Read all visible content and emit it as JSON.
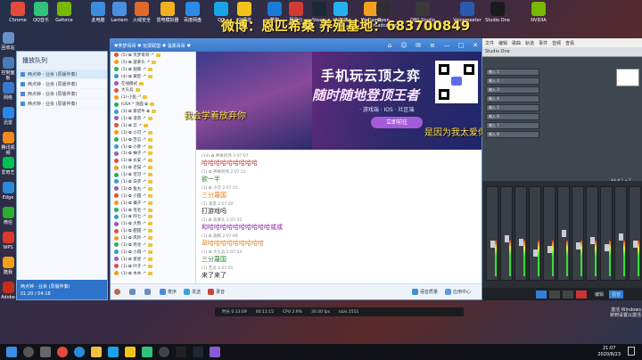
{
  "desktop": {
    "top_icons": [
      {
        "label": "Chrome",
        "color": "#e24b3b"
      },
      {
        "label": "QQ音乐",
        "color": "#31c27c"
      },
      {
        "label": "Geforce",
        "color": "#76b900"
      },
      {
        "label": "此电脑",
        "color": "#3c8ce0"
      },
      {
        "label": "Lantern",
        "color": "#4a8fe0"
      },
      {
        "label": "火绒安全",
        "color": "#e06a2a"
      },
      {
        "label": "雷电模拟器",
        "color": "#f0b020"
      },
      {
        "label": "百度网盘",
        "color": "#2a8ce8"
      },
      {
        "label": "QQ",
        "color": "#1aa3e8"
      },
      {
        "label": "YY语音",
        "color": "#f0c21a"
      },
      {
        "label": "酷狗",
        "color": "#1a7ad8"
      },
      {
        "label": "网易云",
        "color": "#d33a31"
      },
      {
        "label": "Steam",
        "color": "#1b2838"
      },
      {
        "label": "UU加速",
        "color": "#25b1f0"
      },
      {
        "label": "WeGame",
        "color": "#f2a020"
      },
      {
        "label": "Open Broadcaster",
        "color": "#302e31"
      },
      {
        "label": "OBS Studio",
        "color": "#3a3a3a"
      },
      {
        "label": "Voicemeeter",
        "color": "#2a5ab0"
      },
      {
        "label": "Studio One",
        "color": "#1a1a1a"
      },
      {
        "label": "NVIDIA",
        "color": "#76b900"
      }
    ],
    "left_icons": [
      {
        "label": "回收站",
        "color": "#6a90c8"
      },
      {
        "label": "控制面板",
        "color": "#4a7ab8"
      },
      {
        "label": "网络",
        "color": "#3a78d0"
      },
      {
        "label": "迅雷",
        "color": "#2a88e8"
      },
      {
        "label": "腾讯视频",
        "color": "#f08a1a"
      },
      {
        "label": "爱奇艺",
        "color": "#00c050"
      },
      {
        "label": "Edge",
        "color": "#2a8ad8"
      },
      {
        "label": "微信",
        "color": "#2aae32"
      },
      {
        "label": "WPS",
        "color": "#d83a2a"
      },
      {
        "label": "酷我",
        "color": "#f0a01a"
      },
      {
        "label": "Adobe",
        "color": "#c0301a"
      }
    ]
  },
  "overlay": {
    "title": "微博：恩匹希桑 养殖基地：683700849",
    "line_a": "我会学着放弃你",
    "line_b": "是因为我太爱你"
  },
  "playlist": {
    "title": "播放队列",
    "items": [
      "两点钟 - 业余 (原版伴奏)",
      "两点钟 - 业余 (原版伴奏)",
      "两点钟 - 业余 (原版伴奏)",
      "两点钟 - 业余 (原版伴奏)"
    ],
    "now_playing": "两点钟 - 业余 (原版伴奏)",
    "time": "01:20 / 04:18"
  },
  "chat": {
    "window_title": "♥笑梦哥哥 ♥ 玩耍联盟 ♥ 温柔哥哥 ♥",
    "members_header": "在线成员",
    "members": [
      "(5)-✿ 笑梦哥哥 -*",
      "(5)-✿ 菠萝头 -*",
      "(5)-✿ 翅膀 -*",
      "(4)-✿ 黄腔 -*",
      "在线模式",
      "大头兵",
      "(1)-小鱼 -*",
      "IUSA * 汤面 ✿",
      "(3)-✿ 斯诺牛 ✿",
      "(1)-✿ 漆黑 -*",
      "(1)-✿ 云 -*",
      "(1)-✿ 小可 -*",
      "(1)-✿ 苦瓜 -*",
      "(1)-✿ 小胖 -*",
      "(1)-✿ 柚子 -*",
      "(1)-✿ 长安 -*",
      "(1)-✿ 老猫 -*",
      "(1)-✿ 可可 -*",
      "(1)-✿ 白衣 -*",
      "(1)-✿ 鱼丸 -*",
      "(1)-✿ 小甜 -*",
      "(1)-✿ 橘子 -*",
      "(1)-✿ 毛毛 -*",
      "(1)-✿ 阿七 -*",
      "(1)-✿ 大熊 -*",
      "(1)-✿ 甜甜 -*",
      "(1)-✿ 风铃 -*",
      "(1)-✿ 月亮 -*",
      "(1)-✿ 小雨 -*",
      "(1)-✿ 星星 -*",
      "(1)-✿ 叶子 -*",
      "(1)-✿ 木木 -*"
    ],
    "banner": {
      "line1": "手机玩云顶之弈",
      "line2": "随时随地登顶王者",
      "line3": "· 游戏端 · IOS · 社区端",
      "cta": "立即前往"
    },
    "messages": [
      {
        "meta": "(14) ✿ 神奇阿伟 2:07:07",
        "body": "哈哈哈哈哈哈哈哈哈",
        "color": "#c0392b"
      },
      {
        "meta": "(1) ✿ 神奇阿伟 2:07:12",
        "body": "欲一半",
        "color": "#2e7d32"
      },
      {
        "meta": "(3) ✿ 小可 2:07:15",
        "body": "三分蔑国",
        "color": "#e67e22"
      },
      {
        "meta": "(1) 漆黑 2:07:20",
        "body": "打游戏吗",
        "color": "#222222"
      },
      {
        "meta": "(2) ✿ 菠萝头 2:07:35",
        "body": "和哈哈哈哈哈哈哈哈哈哈或或",
        "color": "#8e24aa"
      },
      {
        "meta": "(1) ✿ 翅膀 2:07:49",
        "body": "草哈哈哈哈哈哈哈哈哈",
        "color": "#e67e22"
      },
      {
        "meta": "(1) ✿ 大头兵 2:07:54",
        "body": "三分蔑国",
        "color": "#2e7d32"
      },
      {
        "meta": "(1) 苦瓜 2:07:55",
        "body": "来了来了",
        "color": "#222222"
      }
    ],
    "bottom": {
      "send": "发送",
      "mic": "麦序",
      "record": "录音",
      "quality": "语音质量",
      "apps": "应用中心"
    }
  },
  "daw": {
    "menu": [
      "文件",
      "编辑",
      "歌曲",
      "轨道",
      "事件",
      "音频",
      "查看"
    ],
    "title": "Studio One",
    "tracks": [
      "输入 1",
      "输入 2",
      "输入 3",
      "输入 4",
      "输入 5",
      "输入 6",
      "输入 7",
      "输入 8"
    ],
    "right_label": "Adult 1 + 2",
    "btn_edit": "编辑",
    "btn_mix": "混音"
  },
  "statusbar": {
    "duration": "时长 0:13:09",
    "time": "00:11:15",
    "cpu": "CPU 2.9%",
    "fps": "30.00 fps",
    "kbps": "kb/s 2551"
  },
  "taskbar": {
    "time": "21:07",
    "date": "2020/8/23"
  },
  "watermark": {
    "line1": "激活 Windows",
    "line2": "转到设置以激活"
  }
}
